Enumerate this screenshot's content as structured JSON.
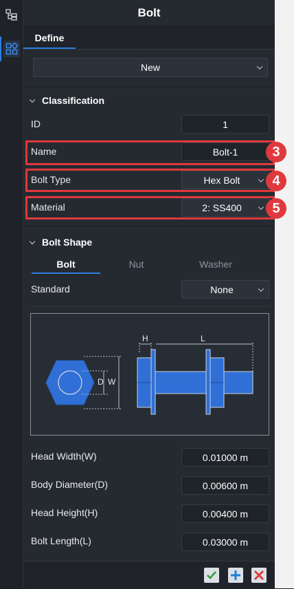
{
  "rail": {
    "tree_icon": "tree-icon",
    "parts_icon": "parts-icon"
  },
  "header": {
    "title": "Bolt"
  },
  "tabs": {
    "define": "Define"
  },
  "new_select": {
    "value": "New"
  },
  "classification": {
    "title": "Classification",
    "id_label": "ID",
    "id_value": "1",
    "name_label": "Name",
    "name_value": "Bolt-1",
    "bolt_type_label": "Bolt Type",
    "bolt_type_value": "Hex Bolt",
    "material_label": "Material",
    "material_value": "2: SS400"
  },
  "callouts": {
    "name": "3",
    "bolt_type": "4",
    "material": "5",
    "color": "#e0393c"
  },
  "bolt_shape": {
    "title": "Bolt Shape",
    "tabs": [
      "Bolt",
      "Nut",
      "Washer"
    ],
    "standard_label": "Standard",
    "standard_value": "None",
    "diagram_labels": {
      "d": "D",
      "w": "W",
      "h": "H",
      "l": "L"
    },
    "head_width_label": "Head Width(W)",
    "head_width_value": "0.01000 m",
    "body_diameter_label": "Body Diameter(D)",
    "body_diameter_value": "0.00600 m",
    "head_height_label": "Head Height(H)",
    "head_height_value": "0.00400 m",
    "bolt_length_label": "Bolt Length(L)",
    "bolt_length_value": "0.03000 m"
  },
  "footer": {
    "ok_icon": "check-icon",
    "add_icon": "plus-icon",
    "cancel_icon": "close-icon"
  },
  "colors": {
    "accent": "#2e7de0",
    "bolt_blue": "#2f6fd6",
    "ok_green": "#2e9d44",
    "cancel_red": "#e0393c"
  }
}
